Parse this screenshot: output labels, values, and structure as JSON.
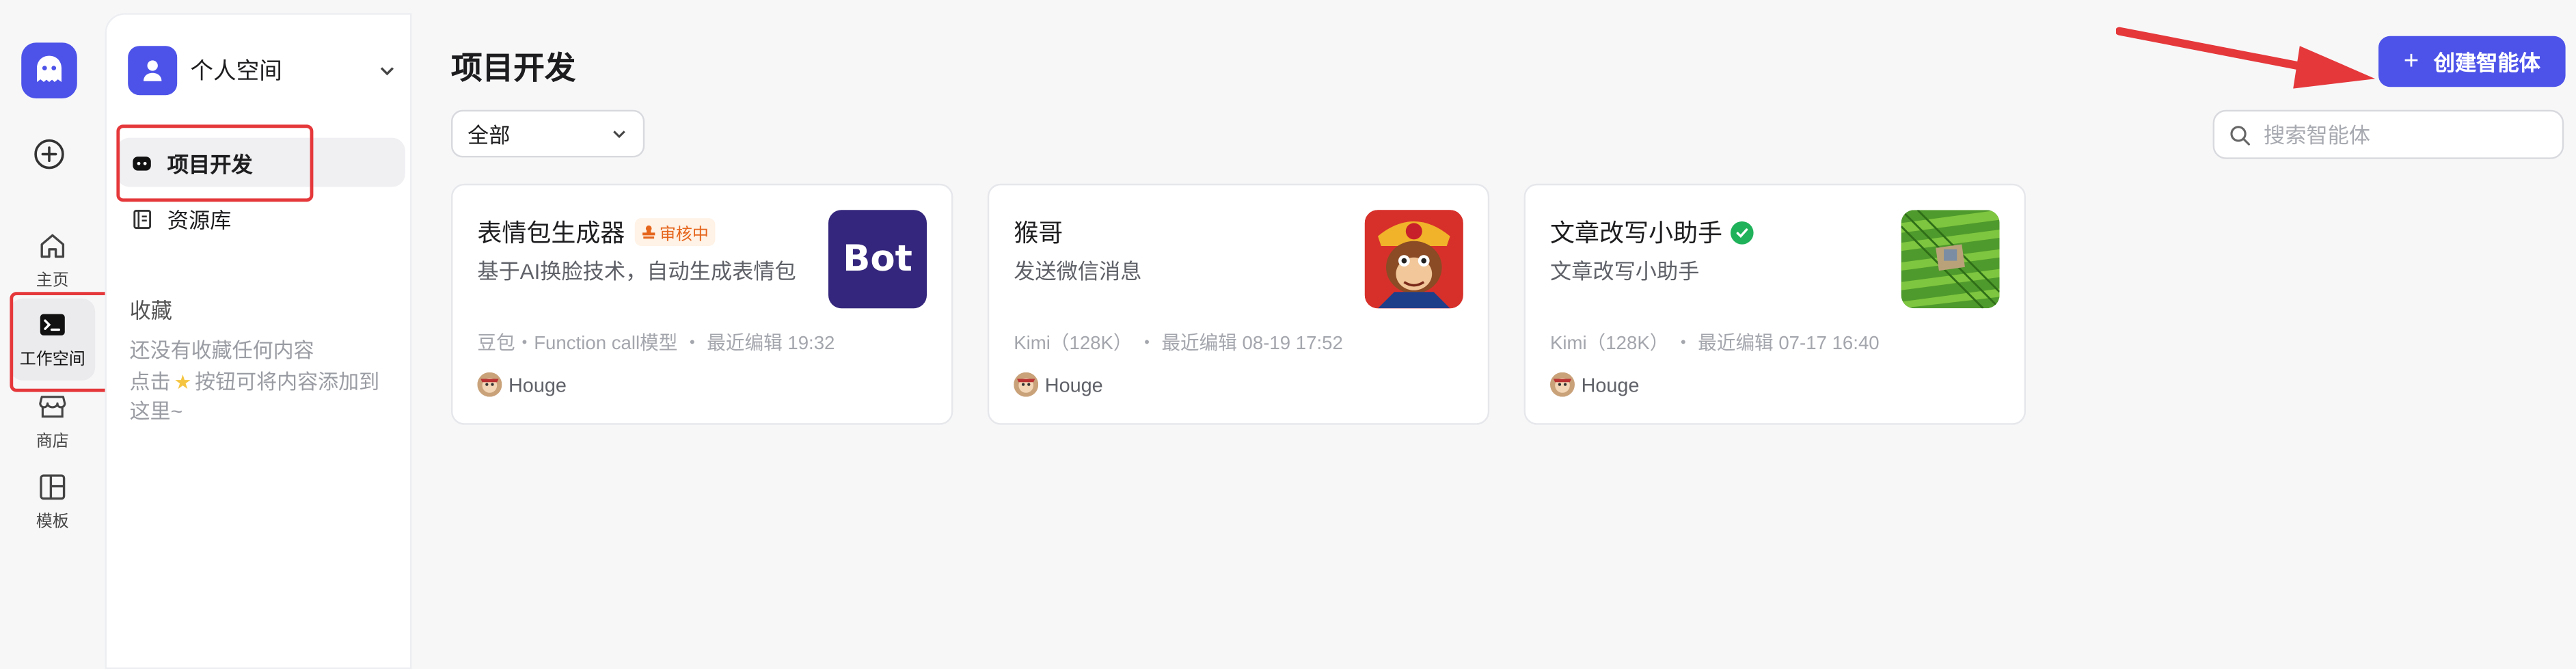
{
  "rail": {
    "items": [
      {
        "label": "主页",
        "icon": "home-icon"
      },
      {
        "label": "工作空间",
        "icon": "terminal-icon"
      },
      {
        "label": "商店",
        "icon": "store-icon"
      },
      {
        "label": "模板",
        "icon": "template-icon"
      }
    ]
  },
  "panel": {
    "space_name": "个人空间",
    "nav": [
      {
        "label": "项目开发",
        "icon": "bot-icon"
      },
      {
        "label": "资源库",
        "icon": "library-icon"
      }
    ],
    "favorites_title": "收藏",
    "favorites_empty_line1": "还没有收藏任何内容",
    "favorites_empty_line2_pre": "点击",
    "favorites_empty_line2_post": "按钮可将内容添加到",
    "favorites_empty_line3": "这里~"
  },
  "main": {
    "title": "项目开发",
    "create_label": "创建智能体",
    "filter_value": "全部",
    "search_placeholder": "搜索智能体",
    "cards": [
      {
        "name": "表情包生成器",
        "badge": "审核中",
        "desc": "基于AI换脸技术，自动生成表情包",
        "thumb_text": "Bot",
        "meta": "豆包・Function call模型  ・ 最近编辑 19:32",
        "owner": "Houge"
      },
      {
        "name": "猴哥",
        "desc": "发送微信消息",
        "meta": "Kimi（128K）  ・ 最近编辑 08-19 17:52",
        "owner": "Houge"
      },
      {
        "name": "文章改写小助手",
        "desc": "文章改写小助手",
        "meta": "Kimi（128K）  ・ 最近编辑 07-17 16:40",
        "owner": "Houge"
      }
    ]
  },
  "colors": {
    "accent": "#4d53e8",
    "highlight": "#e5383b",
    "success": "#20b25b"
  }
}
